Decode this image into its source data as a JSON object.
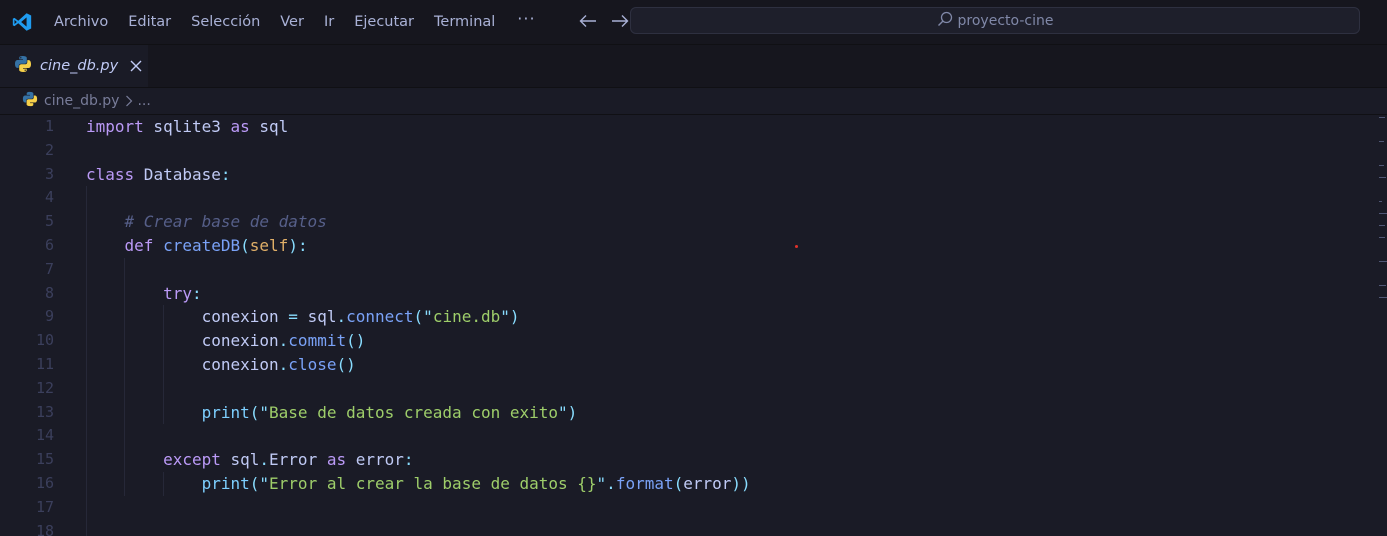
{
  "colors": {
    "background": "#1a1b26",
    "titlebar": "#16161e",
    "keyword": "#bb9af7",
    "function": "#7aa2f7",
    "string": "#9ece6a",
    "comment": "#565f89",
    "accent_blue": "#1f9cf0",
    "python_blue": "#3572A5",
    "python_yellow": "#f7d14a"
  },
  "titlebar": {
    "menu": [
      "Archivo",
      "Editar",
      "Selección",
      "Ver",
      "Ir",
      "Ejecutar",
      "Terminal"
    ],
    "more": "···",
    "search_text": "proyecto-cine",
    "icons": [
      "vscode-logo-icon",
      "arrow-left-icon",
      "arrow-right-icon",
      "search-icon"
    ]
  },
  "tab": {
    "label": "cine_db.py",
    "icon": "python-icon",
    "close_icon": "close-icon"
  },
  "breadcrumb": {
    "file": "cine_db.py",
    "rest": "..."
  },
  "editor": {
    "line_numbers": [
      "1",
      "2",
      "3",
      "4",
      "5",
      "6",
      "7",
      "8",
      "9",
      "10",
      "11",
      "12",
      "13",
      "14",
      "15",
      "16",
      "17",
      "18"
    ],
    "lines": [
      [
        [
          "kw",
          "import"
        ],
        [
          "var",
          " sqlite3 "
        ],
        [
          "kw",
          "as"
        ],
        [
          "var",
          " sql"
        ]
      ],
      [],
      [
        [
          "kw",
          "class"
        ],
        [
          "var",
          " Database"
        ],
        [
          "punc",
          ":"
        ]
      ],
      [],
      [
        [
          "var",
          "    "
        ],
        [
          "cm",
          "# Crear base de datos"
        ]
      ],
      [
        [
          "var",
          "    "
        ],
        [
          "kw",
          "def"
        ],
        [
          "var",
          " "
        ],
        [
          "fn",
          "createDB"
        ],
        [
          "punc",
          "("
        ],
        [
          "self",
          "self"
        ],
        [
          "punc",
          "):"
        ]
      ],
      [],
      [
        [
          "var",
          "        "
        ],
        [
          "kw",
          "try"
        ],
        [
          "punc",
          ":"
        ]
      ],
      [
        [
          "var",
          "            conexion "
        ],
        [
          "punc",
          "="
        ],
        [
          "var",
          " sql"
        ],
        [
          "punc",
          "."
        ],
        [
          "fn",
          "connect"
        ],
        [
          "punc",
          "(\""
        ],
        [
          "str",
          "cine.db"
        ],
        [
          "punc",
          "\")"
        ]
      ],
      [
        [
          "var",
          "            conexion"
        ],
        [
          "punc",
          "."
        ],
        [
          "fn",
          "commit"
        ],
        [
          "punc",
          "()"
        ]
      ],
      [
        [
          "var",
          "            conexion"
        ],
        [
          "punc",
          "."
        ],
        [
          "fn",
          "close"
        ],
        [
          "punc",
          "()"
        ]
      ],
      [],
      [
        [
          "var",
          "            "
        ],
        [
          "prop",
          "print"
        ],
        [
          "punc",
          "(\""
        ],
        [
          "str",
          "Base de datos creada con exito"
        ],
        [
          "punc",
          "\")"
        ]
      ],
      [],
      [
        [
          "var",
          "        "
        ],
        [
          "kw",
          "except"
        ],
        [
          "var",
          " sql"
        ],
        [
          "punc",
          "."
        ],
        [
          "var",
          "Error "
        ],
        [
          "kw",
          "as"
        ],
        [
          "var",
          " error"
        ],
        [
          "punc",
          ":"
        ]
      ],
      [
        [
          "var",
          "            "
        ],
        [
          "prop",
          "print"
        ],
        [
          "punc",
          "(\""
        ],
        [
          "str",
          "Error al crear la base de datos {}"
        ],
        [
          "punc",
          "\"."
        ],
        [
          "fn",
          "format"
        ],
        [
          "punc",
          "("
        ],
        [
          "var",
          "error"
        ],
        [
          "punc",
          "))"
        ]
      ],
      [],
      []
    ]
  }
}
